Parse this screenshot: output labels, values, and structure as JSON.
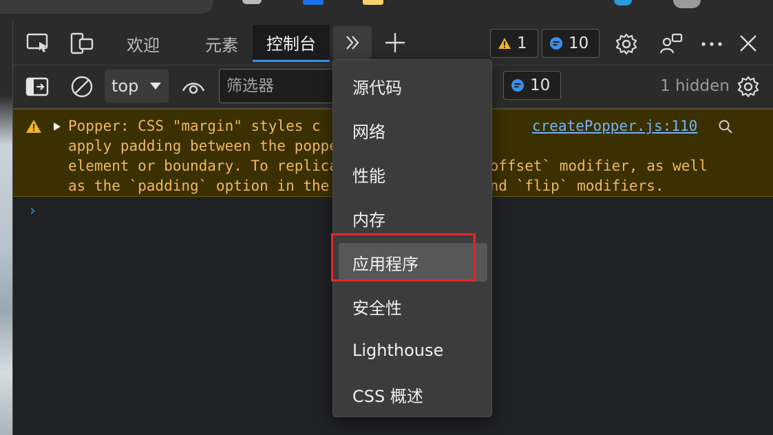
{
  "tabs": {
    "welcome": "欢迎",
    "elements": "元素",
    "console": "控制台"
  },
  "badges": {
    "warnings_count": "1",
    "messages_count": "10"
  },
  "console_toolbar": {
    "context_value": "top",
    "filter_placeholder": "筛选器",
    "messages_count": "10",
    "hidden_count": "1 hidden"
  },
  "warning": {
    "text": "Popper: CSS \"margin\" styles c\napply padding between the popper\nelement or boundary. To replicat\nas the `padding` option in the `",
    "text_right": "e\n`offset` modifier, as well\nand `flip` modifiers.",
    "source_link": "createPopper.js:110"
  },
  "more_tools_menu": {
    "items": [
      "源代码",
      "网络",
      "性能",
      "内存",
      "应用程序",
      "安全性",
      "Lighthouse",
      "CSS 概述"
    ],
    "highlighted_item": "应用程序"
  },
  "colors": {
    "accent": "#3b8eea",
    "warning_bg": "#3a3000",
    "warning_text": "#f2b85b",
    "annotation_red": "#e3262b"
  }
}
